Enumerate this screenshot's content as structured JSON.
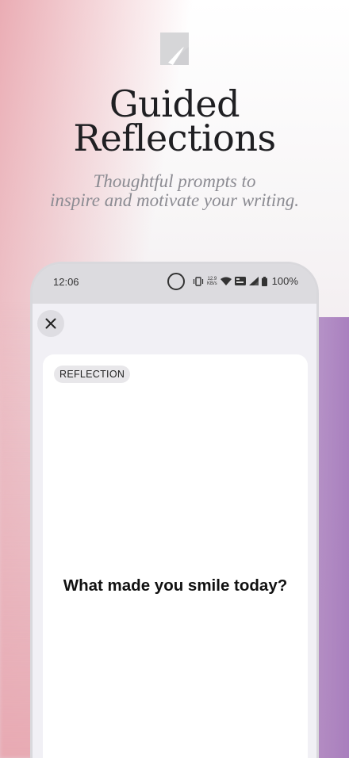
{
  "header": {
    "logo_icon": "page-curl-icon",
    "title_line1": "Guided",
    "title_line2": "Reflections",
    "subtitle_line1": "Thoughtful prompts to",
    "subtitle_line2": "inspire and motivate your writing."
  },
  "status_bar": {
    "time": "12:06",
    "speed_value": "12.9",
    "speed_unit": "KB/s",
    "battery": "100%",
    "icons": [
      "record-circle-icon",
      "vibrate-icon",
      "wifi-icon",
      "vowifi-icon",
      "signal-icon",
      "battery-icon"
    ]
  },
  "screen": {
    "close_icon": "close-icon",
    "badge": "REFLECTION",
    "prompt": "What made you smile today?"
  },
  "colors": {
    "pink_accent": "#e8a8b0",
    "purple_accent": "#a67dbc"
  }
}
